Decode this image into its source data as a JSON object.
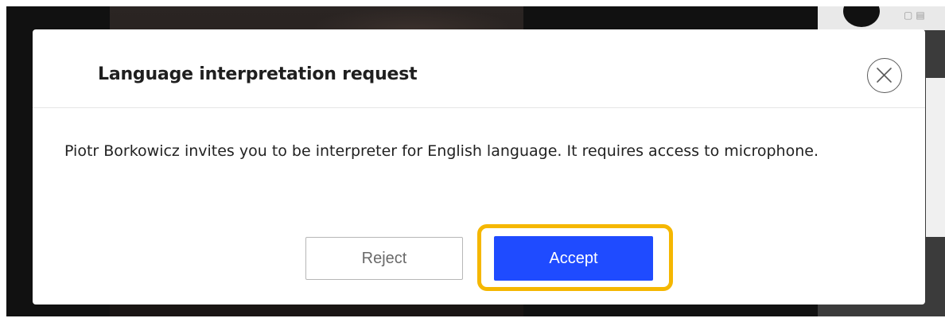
{
  "dialog": {
    "title": "Language interpretation request",
    "message": "Piotr Borkowicz invites you to be interpreter for English language. It requires access to microphone.",
    "close_icon": "close-icon",
    "reject_label": "Reject",
    "accept_label": "Accept"
  },
  "colors": {
    "accent_button": "#1f4bff",
    "highlight": "#f5b700"
  }
}
